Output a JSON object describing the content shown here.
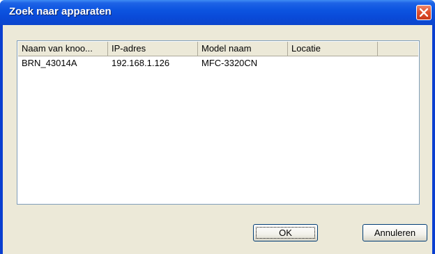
{
  "window": {
    "title": "Zoek naar apparaten"
  },
  "list": {
    "columns": [
      "Naam van knoo...",
      "IP-adres",
      "Model naam",
      "Locatie"
    ],
    "rows": [
      [
        "BRN_43014A",
        "192.168.1.126",
        "MFC-3320CN",
        ""
      ]
    ]
  },
  "buttons": {
    "ok_label": "OK",
    "cancel_label": "Annuleren"
  },
  "icons": {
    "close": "close-icon"
  }
}
